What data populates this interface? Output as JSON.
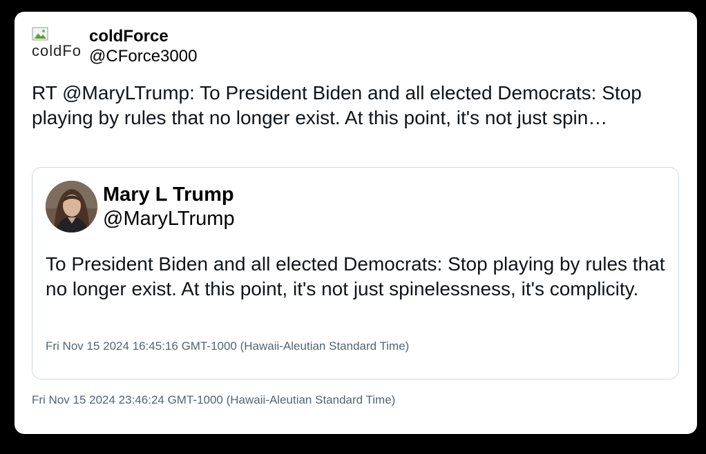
{
  "tweet": {
    "avatar_alt": "coldForce",
    "display_name": "coldForce",
    "handle": "@CForce3000",
    "text": "RT @MaryLTrump: To President Biden and all elected Democrats: Stop playing by rules that no longer exist. At this point, it's not just spin…",
    "timestamp": "Fri Nov 15 2024 23:46:24 GMT-1000 (Hawaii-Aleutian Standard Time)"
  },
  "quoted": {
    "display_name": "Mary L Trump",
    "handle": "@MaryLTrump",
    "text": "To President Biden and all elected Democrats: Stop playing by rules that no longer exist. At this point, it's not just spinelessness, it's complicity.",
    "timestamp": "Fri Nov 15 2024 16:45:16 GMT-1000 (Hawaii-Aleutian Standard Time)"
  },
  "colors": {
    "background": "#000000",
    "card": "#ffffff",
    "border": "#cfd9de",
    "muted_text": "#536471",
    "body_text": "#0f1419"
  }
}
